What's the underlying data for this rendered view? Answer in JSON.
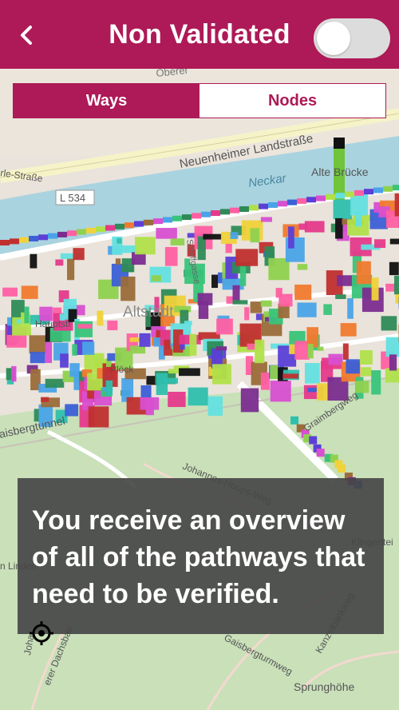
{
  "header": {
    "title": "Non Validated",
    "back_icon": "chevron-left-icon",
    "toggle_state": "off",
    "background_color": "#ad1a57"
  },
  "tabs": [
    {
      "label": "Ways",
      "active": true
    },
    {
      "label": "Nodes",
      "active": false
    }
  ],
  "map": {
    "labels": {
      "oberer": "Oberer",
      "neuenheimer": "Neuenheimer Landstraße",
      "neckar": "Neckar",
      "alte_brucke": "Alte Brücke",
      "l534": "L 534",
      "erle_strasse": "rle-Straße",
      "schiffgasse": "Schiffgasse",
      "hauptstr": "Hauptstr",
      "altstadt": "Altstadt",
      "plock": "Plöck",
      "graimbergweg": "Graimbergweg",
      "aisbergtunnel": "aisbergtunnel",
      "johannes_hoops": "Johannes-Hoops-Weg",
      "klingenteich": "Klingentei",
      "linden": "n Linden",
      "dachsbau": "erer Dachsbau",
      "kanzelbankweg": "Kanzelbankweg",
      "gaisbergturmweg": "Gaisbergturmweg",
      "sprunghohe": "Sprunghöhe",
      "johann": "Joha"
    },
    "colors": {
      "water": "#a9d3df",
      "land": "#e9e3db",
      "forest": "#c5dfb5",
      "road": "#ffffff",
      "main_road": "#f4f1c4"
    }
  },
  "overlay": {
    "text": "You receive an overview of all of the pathways that need to be verified."
  },
  "locate_icon": "crosshair-icon"
}
